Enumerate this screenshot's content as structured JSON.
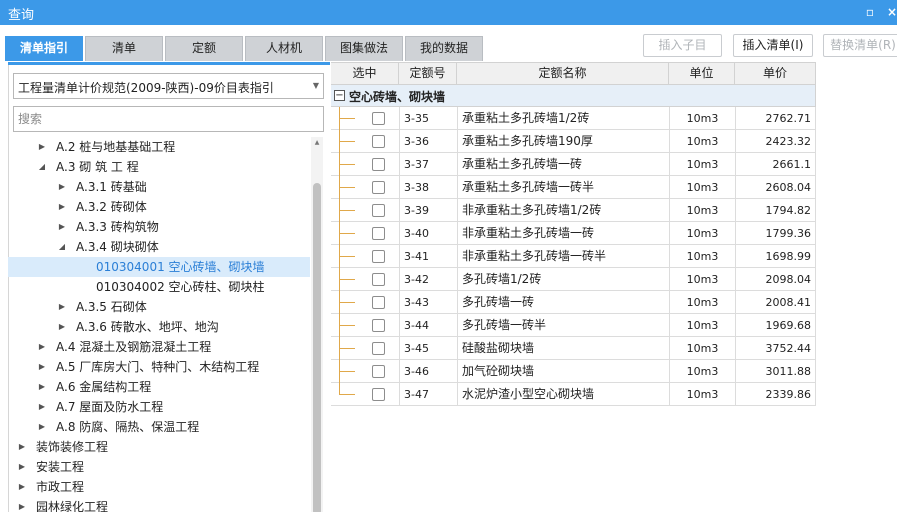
{
  "window": {
    "title": "查询"
  },
  "tabs": [
    {
      "label": "清单指引",
      "active": true
    },
    {
      "label": "清单"
    },
    {
      "label": "定额"
    },
    {
      "label": "人材机"
    },
    {
      "label": "图集做法"
    },
    {
      "label": "我的数据"
    }
  ],
  "toolbar": {
    "insert_child": "插入子目",
    "insert_list": "插入清单(I)",
    "replace_list": "替换清单(R)"
  },
  "left": {
    "spec_value": "工程量清单计价规范(2009-陕西)-09价目表指引",
    "search_placeholder": "搜索",
    "tree": [
      {
        "label": "A.2  桩与地基基础工程",
        "level": 1,
        "toggle": "collapsed"
      },
      {
        "label": "A.3  砌 筑 工 程",
        "level": 1,
        "toggle": "expanded"
      },
      {
        "label": "A.3.1  砖基础",
        "level": 2,
        "toggle": "collapsed"
      },
      {
        "label": "A.3.2  砖砌体",
        "level": 2,
        "toggle": "collapsed"
      },
      {
        "label": "A.3.3  砖构筑物",
        "level": 2,
        "toggle": "collapsed"
      },
      {
        "label": "A.3.4  砌块砌体",
        "level": 2,
        "toggle": "expanded"
      },
      {
        "label": "010304001  空心砖墙、砌块墙",
        "level": 3,
        "toggle": "none",
        "selected": true
      },
      {
        "label": "010304002  空心砖柱、砌块柱",
        "level": 3,
        "toggle": "none"
      },
      {
        "label": "A.3.5  石砌体",
        "level": 2,
        "toggle": "collapsed"
      },
      {
        "label": "A.3.6  砖散水、地坪、地沟",
        "level": 2,
        "toggle": "collapsed"
      },
      {
        "label": "A.4  混凝土及钢筋混凝土工程",
        "level": 1,
        "toggle": "collapsed"
      },
      {
        "label": "A.5  厂库房大门、特种门、木结构工程",
        "level": 1,
        "toggle": "collapsed"
      },
      {
        "label": "A.6  金属结构工程",
        "level": 1,
        "toggle": "collapsed"
      },
      {
        "label": "A.7  屋面及防水工程",
        "level": 1,
        "toggle": "collapsed"
      },
      {
        "label": "A.8  防腐、隔热、保温工程",
        "level": 1,
        "toggle": "collapsed"
      },
      {
        "label": "装饰装修工程",
        "level": 0,
        "toggle": "collapsed"
      },
      {
        "label": "安装工程",
        "level": 0,
        "toggle": "collapsed"
      },
      {
        "label": "市政工程",
        "level": 0,
        "toggle": "collapsed"
      },
      {
        "label": "园林绿化工程",
        "level": 0,
        "toggle": "collapsed"
      }
    ]
  },
  "grid": {
    "headers": {
      "select": "选中",
      "code": "定额号",
      "name": "定额名称",
      "unit": "单位",
      "price": "单价"
    },
    "group_label": "空心砖墙、砌块墙",
    "rows": [
      {
        "code": "3-35",
        "name": "承重粘土多孔砖墙1/2砖",
        "unit": "10m3",
        "price": "2762.71"
      },
      {
        "code": "3-36",
        "name": "承重粘土多孔砖墙190厚",
        "unit": "10m3",
        "price": "2423.32"
      },
      {
        "code": "3-37",
        "name": "承重粘土多孔砖墙一砖",
        "unit": "10m3",
        "price": "2661.1"
      },
      {
        "code": "3-38",
        "name": "承重粘土多孔砖墙一砖半",
        "unit": "10m3",
        "price": "2608.04"
      },
      {
        "code": "3-39",
        "name": "非承重粘土多孔砖墙1/2砖",
        "unit": "10m3",
        "price": "1794.82"
      },
      {
        "code": "3-40",
        "name": "非承重粘土多孔砖墙一砖",
        "unit": "10m3",
        "price": "1799.36"
      },
      {
        "code": "3-41",
        "name": "非承重粘土多孔砖墙一砖半",
        "unit": "10m3",
        "price": "1698.99"
      },
      {
        "code": "3-42",
        "name": "多孔砖墙1/2砖",
        "unit": "10m3",
        "price": "2098.04"
      },
      {
        "code": "3-43",
        "name": "多孔砖墙一砖",
        "unit": "10m3",
        "price": "2008.41"
      },
      {
        "code": "3-44",
        "name": "多孔砖墙一砖半",
        "unit": "10m3",
        "price": "1969.68"
      },
      {
        "code": "3-45",
        "name": "硅酸盐砌块墙",
        "unit": "10m3",
        "price": "3752.44"
      },
      {
        "code": "3-46",
        "name": "加气砼砌块墙",
        "unit": "10m3",
        "price": "3011.88"
      },
      {
        "code": "3-47",
        "name": "水泥炉渣小型空心砌块墙",
        "unit": "10m3",
        "price": "2339.86"
      }
    ]
  },
  "colors": {
    "accent": "#3c99e8",
    "selected_row": "#d9ebfb",
    "group_row": "#e6eff8",
    "tree_line": "#e0a84a"
  }
}
